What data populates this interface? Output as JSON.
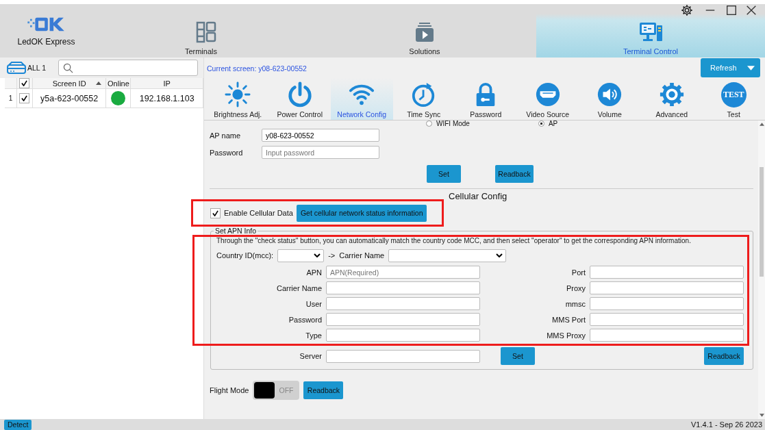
{
  "app": {
    "name": "LedOK Express"
  },
  "nav_tabs": [
    {
      "label": "Terminals",
      "selected": false
    },
    {
      "label": "Solutions",
      "selected": false
    },
    {
      "label": "Terminal Control",
      "selected": true
    }
  ],
  "sidebar": {
    "group_label": "ALL 1"
  },
  "table": {
    "header_checked": true,
    "columns": [
      "Screen ID",
      "Online",
      "IP"
    ],
    "rows": [
      {
        "index": "1",
        "checked": true,
        "screen_id": "y5a-623-00552",
        "online": true,
        "ip": "192.168.1.103"
      }
    ]
  },
  "current_screen": "Current screen: y08-623-00552",
  "refresh_button": "Refresh",
  "tools": [
    {
      "label": "Brightness Adj.",
      "selected": false
    },
    {
      "label": "Power Control",
      "selected": false
    },
    {
      "label": "Network Config",
      "selected": true
    },
    {
      "label": "Time Sync",
      "selected": false
    },
    {
      "label": "Password",
      "selected": false
    },
    {
      "label": "Video Source",
      "selected": false
    },
    {
      "label": "Volume",
      "selected": false
    },
    {
      "label": "Advanced",
      "selected": false
    },
    {
      "label": "Test",
      "selected": false,
      "icon_text": "TEST"
    }
  ],
  "wifi": {
    "modes": [
      {
        "label": "WIFI Mode",
        "selected": false
      },
      {
        "label": "AP",
        "selected": true
      }
    ],
    "ap_name_label": "AP name",
    "ap_name": "y08-623-00552",
    "password_label": "Password",
    "password_placeholder": "Input password",
    "set": "Set",
    "readback": "Readback"
  },
  "cellular": {
    "title": "Cellular Config",
    "enable_label": "Enable Cellular Data",
    "enabled": true,
    "highlighted": true,
    "status_button": "Get cellular network status information"
  },
  "apn": {
    "legend": "Set APN Info",
    "hint": "Through the \"check status\" button, you can automatically match the country code MCC, and then select \"operator\" to get the corresponding APN information.",
    "country_label": "Country ID(mcc):",
    "arrow": "->",
    "carrier_label": "Carrier Name",
    "highlighted": true,
    "fields_left": [
      {
        "label": "APN",
        "placeholder": "APN(Required)"
      },
      {
        "label": "Carrier Name"
      },
      {
        "label": "User"
      },
      {
        "label": "Password"
      },
      {
        "label": "Type"
      }
    ],
    "fields_right": [
      {
        "label": "Port"
      },
      {
        "label": "Proxy"
      },
      {
        "label": "mmsc"
      },
      {
        "label": "MMS Port"
      },
      {
        "label": "MMS Proxy"
      }
    ],
    "server_label": "Server",
    "set": "Set",
    "readback": "Readback"
  },
  "flight_mode": {
    "label": "Flight Mode",
    "on": false,
    "state_text": "OFF",
    "readback": "Readback"
  },
  "status_bar": {
    "detect": "Detect",
    "version": "V1.4.1 - Sep 26 2023"
  }
}
